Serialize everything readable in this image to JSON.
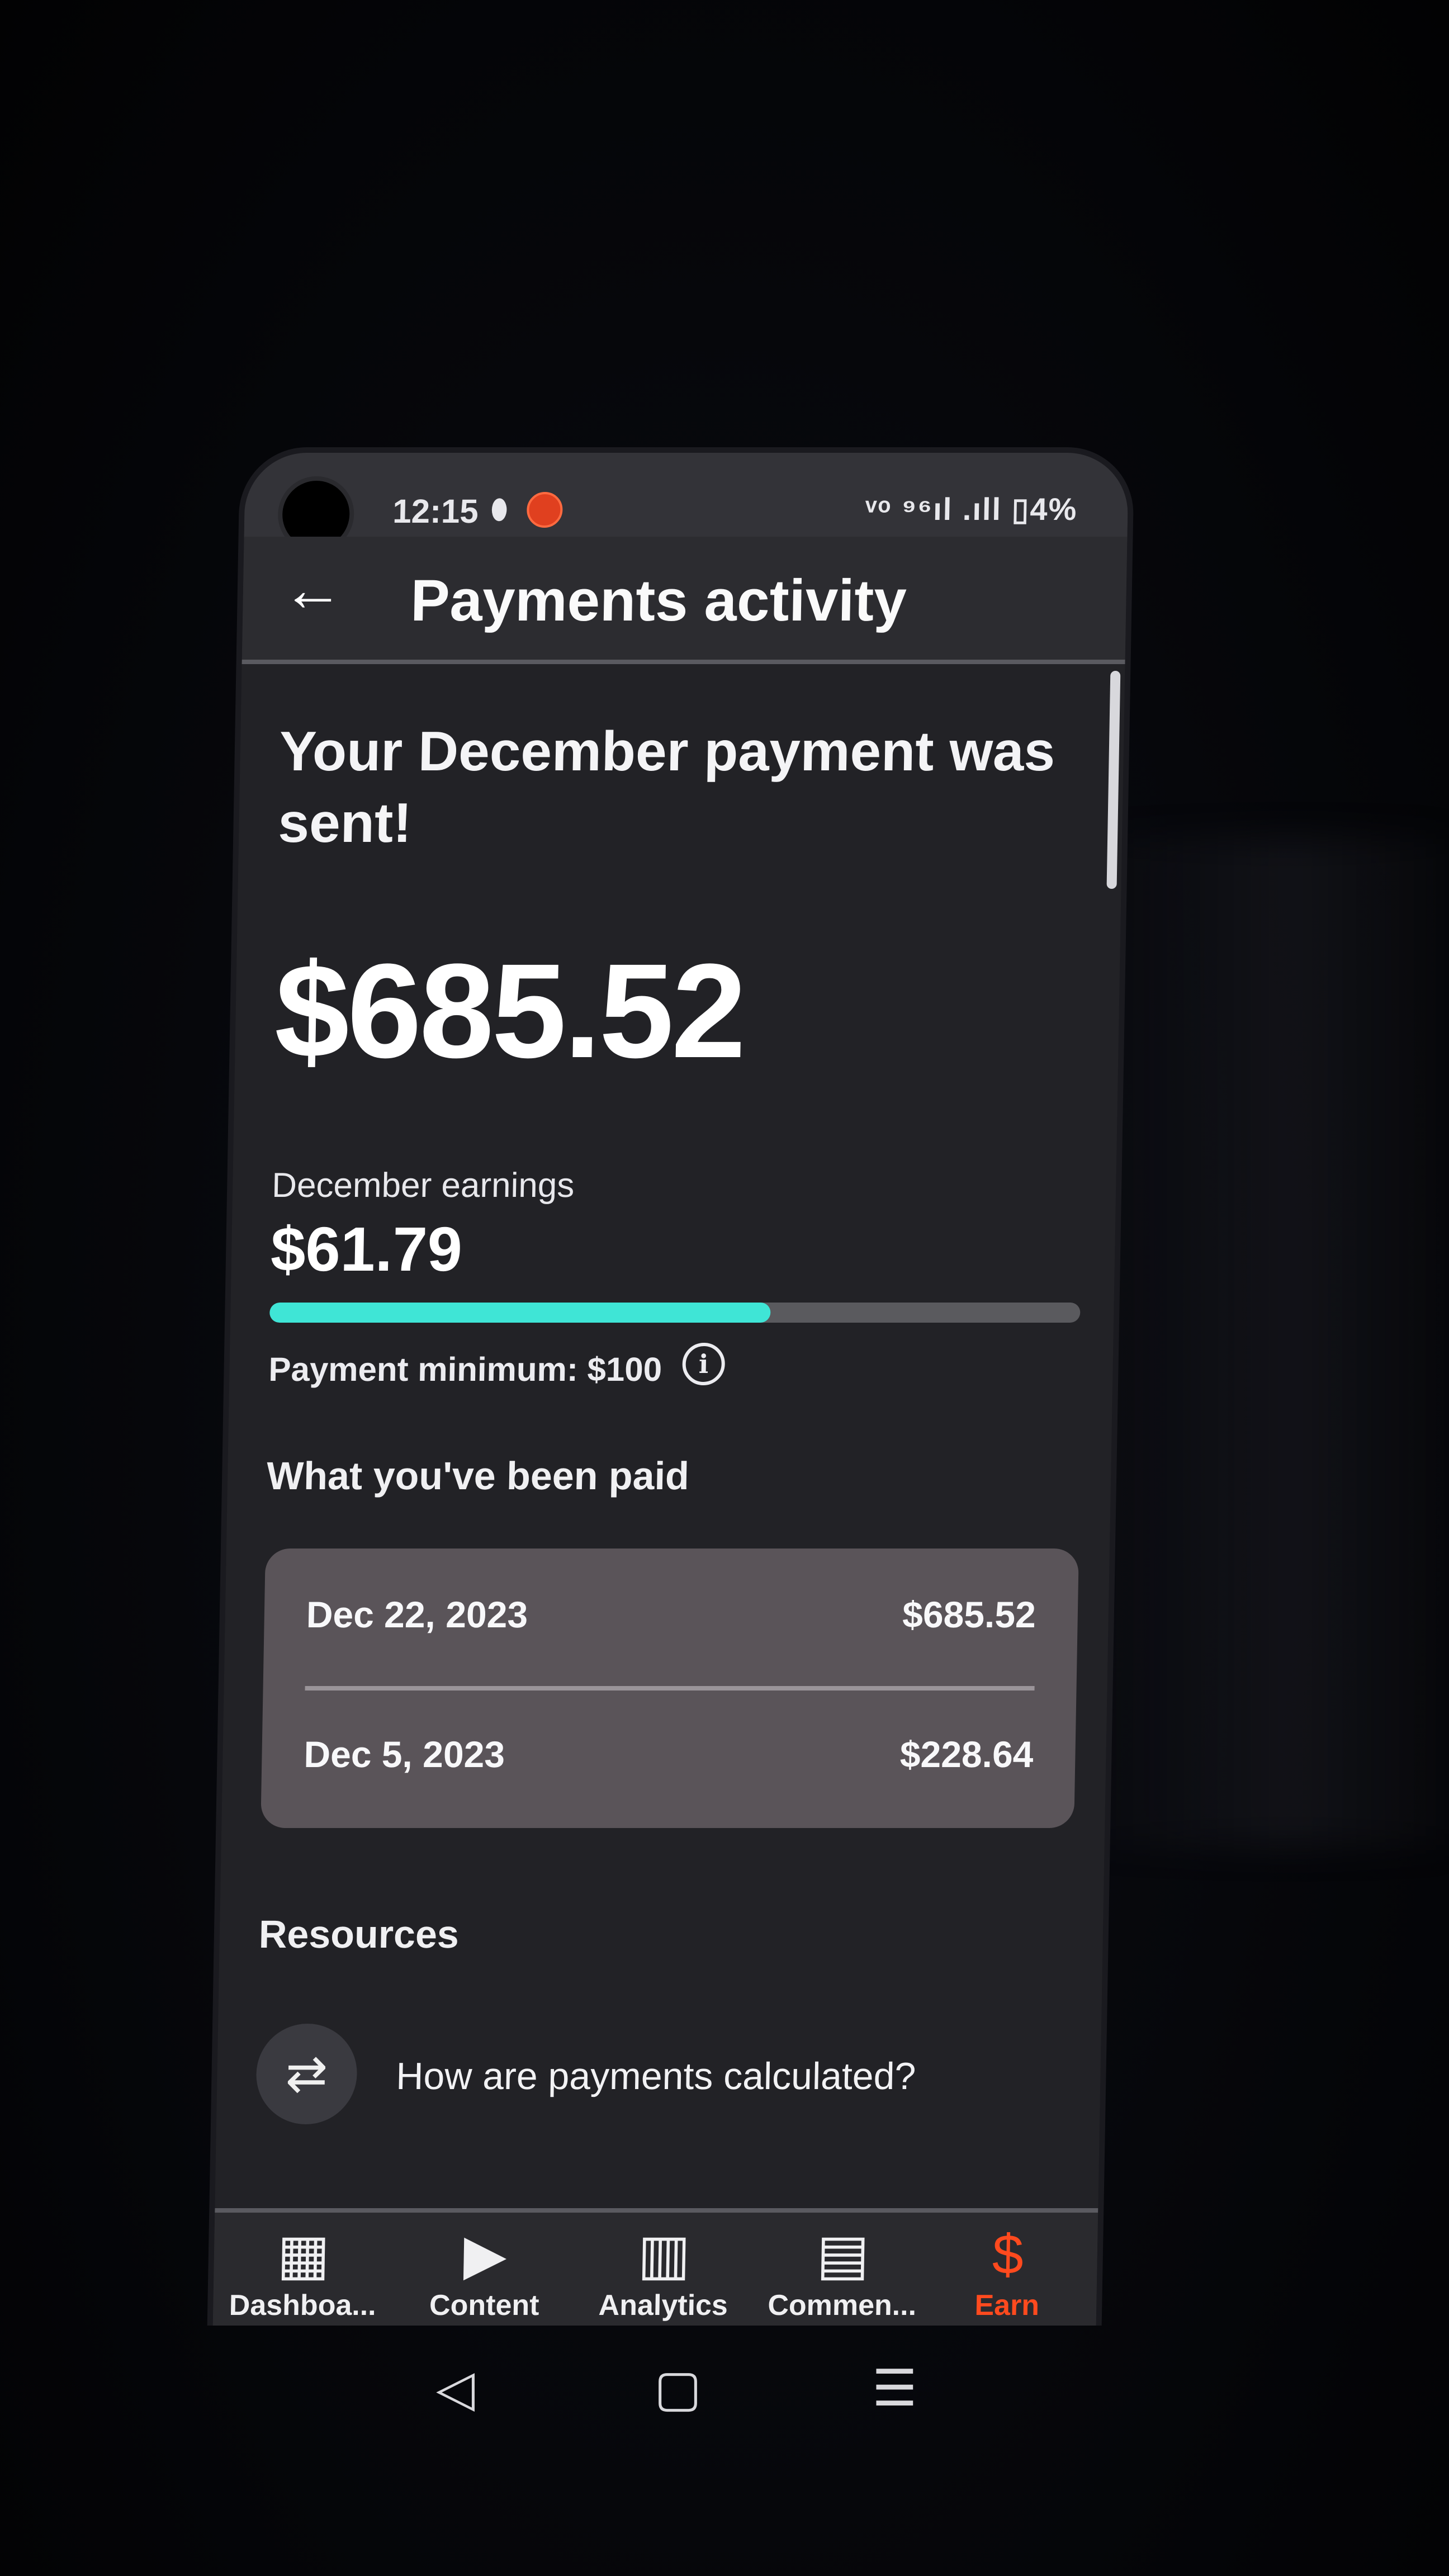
{
  "status_bar": {
    "time": "12:15",
    "right": "ᵛᵒ ⁹⁶ıl .ıll ▯4%"
  },
  "header": {
    "title": "Payments activity"
  },
  "payment": {
    "headline": "Your December payment was sent!",
    "amount": "$685.52",
    "earnings_label": "December earnings",
    "earnings_value": "$61.79",
    "progress_fraction": 0.6179,
    "minimum_label": "Payment minimum: $100"
  },
  "paid": {
    "title": "What you've been paid",
    "rows": [
      {
        "date": "Dec 22, 2023",
        "amount": "$685.52"
      },
      {
        "date": "Dec 5, 2023",
        "amount": "$228.64"
      }
    ]
  },
  "resources": {
    "title": "Resources",
    "items": [
      {
        "label": "How are payments calculated?",
        "icon": "payments-icon"
      }
    ]
  },
  "bottom_nav": {
    "items": [
      {
        "label": "Dashboa...",
        "icon": "dashboard-icon",
        "active": false
      },
      {
        "label": "Content",
        "icon": "content-icon",
        "active": false
      },
      {
        "label": "Analytics",
        "icon": "analytics-icon",
        "active": false
      },
      {
        "label": "Commen...",
        "icon": "comments-icon",
        "active": false
      },
      {
        "label": "Earn",
        "icon": "earn-icon",
        "active": true
      }
    ]
  },
  "colors": {
    "accent": "#3fe5d6",
    "active_nav": "#ff4a1e",
    "background": "#222226"
  }
}
